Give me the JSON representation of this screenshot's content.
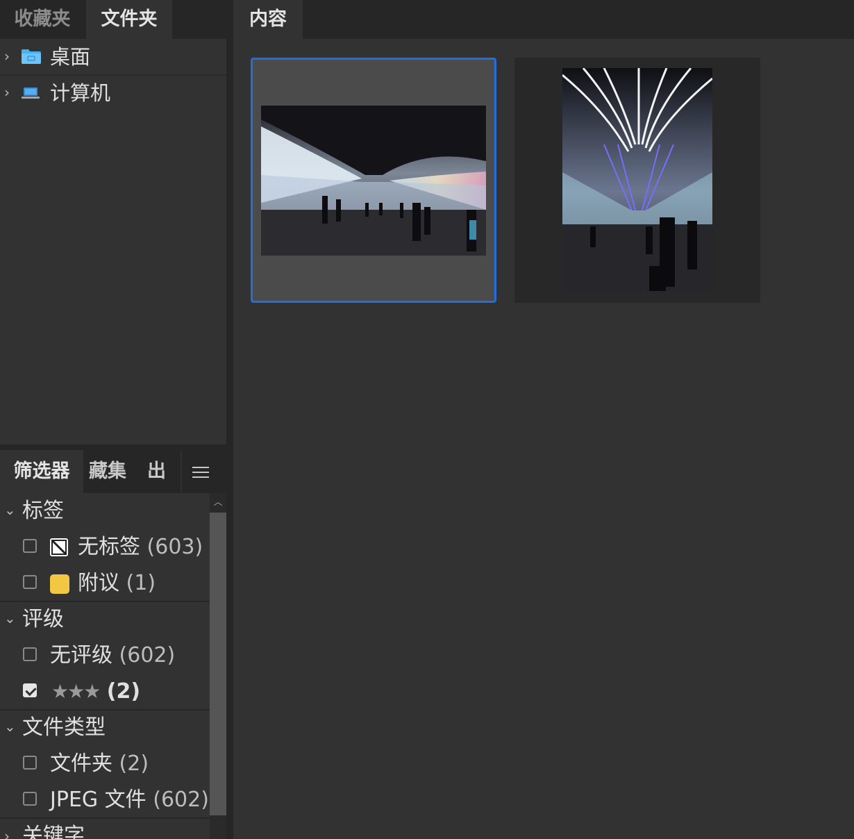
{
  "left_tabs": [
    {
      "label": "收藏夹",
      "active": false
    },
    {
      "label": "文件夹",
      "active": true
    }
  ],
  "tree": [
    {
      "label": "桌面",
      "icon": "folder-icon"
    },
    {
      "label": "计算机",
      "icon": "computer-icon"
    }
  ],
  "filter_tabs": [
    {
      "label": "筛选器",
      "active": true
    },
    {
      "label": "藏集",
      "active": false
    },
    {
      "label": "出",
      "active": false
    }
  ],
  "filter_menu_icon": "hamburger-menu-icon",
  "filters": {
    "label_section": {
      "title": "标签",
      "items": [
        {
          "name": "无标签",
          "count": "(603)",
          "checked": false,
          "swatch": "none"
        },
        {
          "name": "附议",
          "count": "(1)",
          "checked": false,
          "swatch": "#f2c744"
        }
      ]
    },
    "rating_section": {
      "title": "评级",
      "items": [
        {
          "name": "无评级",
          "count": "(602)",
          "checked": false
        },
        {
          "name": "★★★",
          "count": "(2)",
          "checked": true
        }
      ]
    },
    "type_section": {
      "title": "文件类型",
      "items": [
        {
          "name": "文件夹",
          "count": "(2)",
          "checked": false
        },
        {
          "name": "JPEG 文件",
          "count": "(602)",
          "checked": false
        }
      ]
    },
    "keyword_section": {
      "title": "关键字"
    }
  },
  "content": {
    "tab_label": "内容",
    "thumbnails": [
      {
        "orientation": "landscape",
        "selected": true,
        "subject": "illuminated airport walkway tunnel"
      },
      {
        "orientation": "portrait",
        "selected": false,
        "subject": "illuminated airport walkway with neon ceiling"
      }
    ]
  },
  "colors": {
    "accent": "#1f6fe0",
    "panel": "#323232",
    "header": "#262626",
    "folder": "#4ab0f0"
  }
}
